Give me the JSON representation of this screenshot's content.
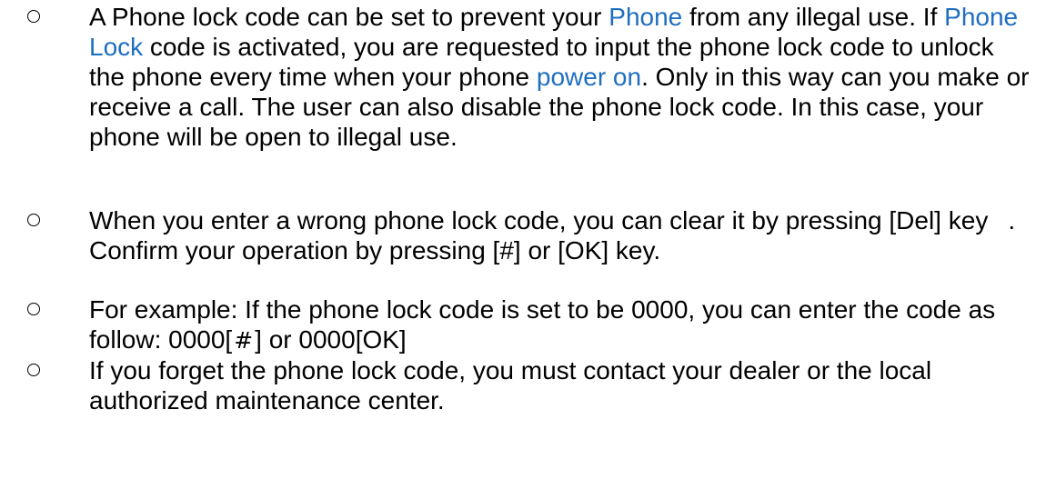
{
  "items": [
    {
      "t1": "A Phone lock code can be set to prevent your ",
      "l1": "Phone",
      "t2": " from any illegal use. If ",
      "l2": "Phone Lock",
      "t3": " code is activated, you are requested to input the phone lock code to unlock the phone every time when your phone ",
      "l3": "power on",
      "t4": ". Only in this way can you make or receive a call. The user can also disable the phone lock code. In this case, your phone will be open to illegal use."
    },
    {
      "t1": "When you enter a wrong phone lock code, you can clear it by pressing [Del] key",
      "t2": ". Confirm your operation by pressing [#] or [OK] key."
    },
    {
      "t1": "For example: If the phone lock code is set to be 0000, you can enter the code as follow: 0000[",
      "hash": "#",
      "t2": "] or 0000[OK]"
    },
    {
      "t1": "If you forget the phone lock code, you must contact your dealer or the local authorized maintenance center."
    }
  ],
  "colors": {
    "link": "#1f6fbf",
    "text": "#000000"
  }
}
